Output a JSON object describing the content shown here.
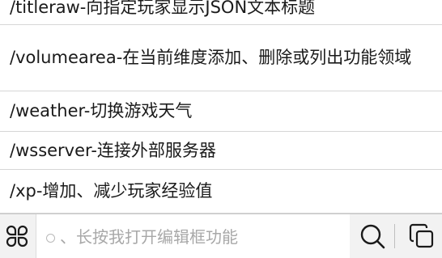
{
  "commands": [
    {
      "text": "/titleraw-向指定玩家显示JSON文本标题"
    },
    {
      "text": "/volumearea-在当前维度添加、删除或列出功能领域"
    },
    {
      "text": "/weather-切换游戏天气"
    },
    {
      "text": "/wsserver-连接外部服务器"
    },
    {
      "text": "/xp-增加、减少玩家经验值"
    }
  ],
  "bottom_bar": {
    "apps_icon": "grid-apps-icon",
    "search_placeholder": "、长按我打开编辑框功能",
    "search_icon": "search-icon",
    "copy_icon": "copy-icon"
  },
  "colors": {
    "text": "#1a1a1a",
    "divider": "#d6d6d6",
    "bar_background": "#f2f2f2",
    "placeholder": "#a8a8a8"
  }
}
